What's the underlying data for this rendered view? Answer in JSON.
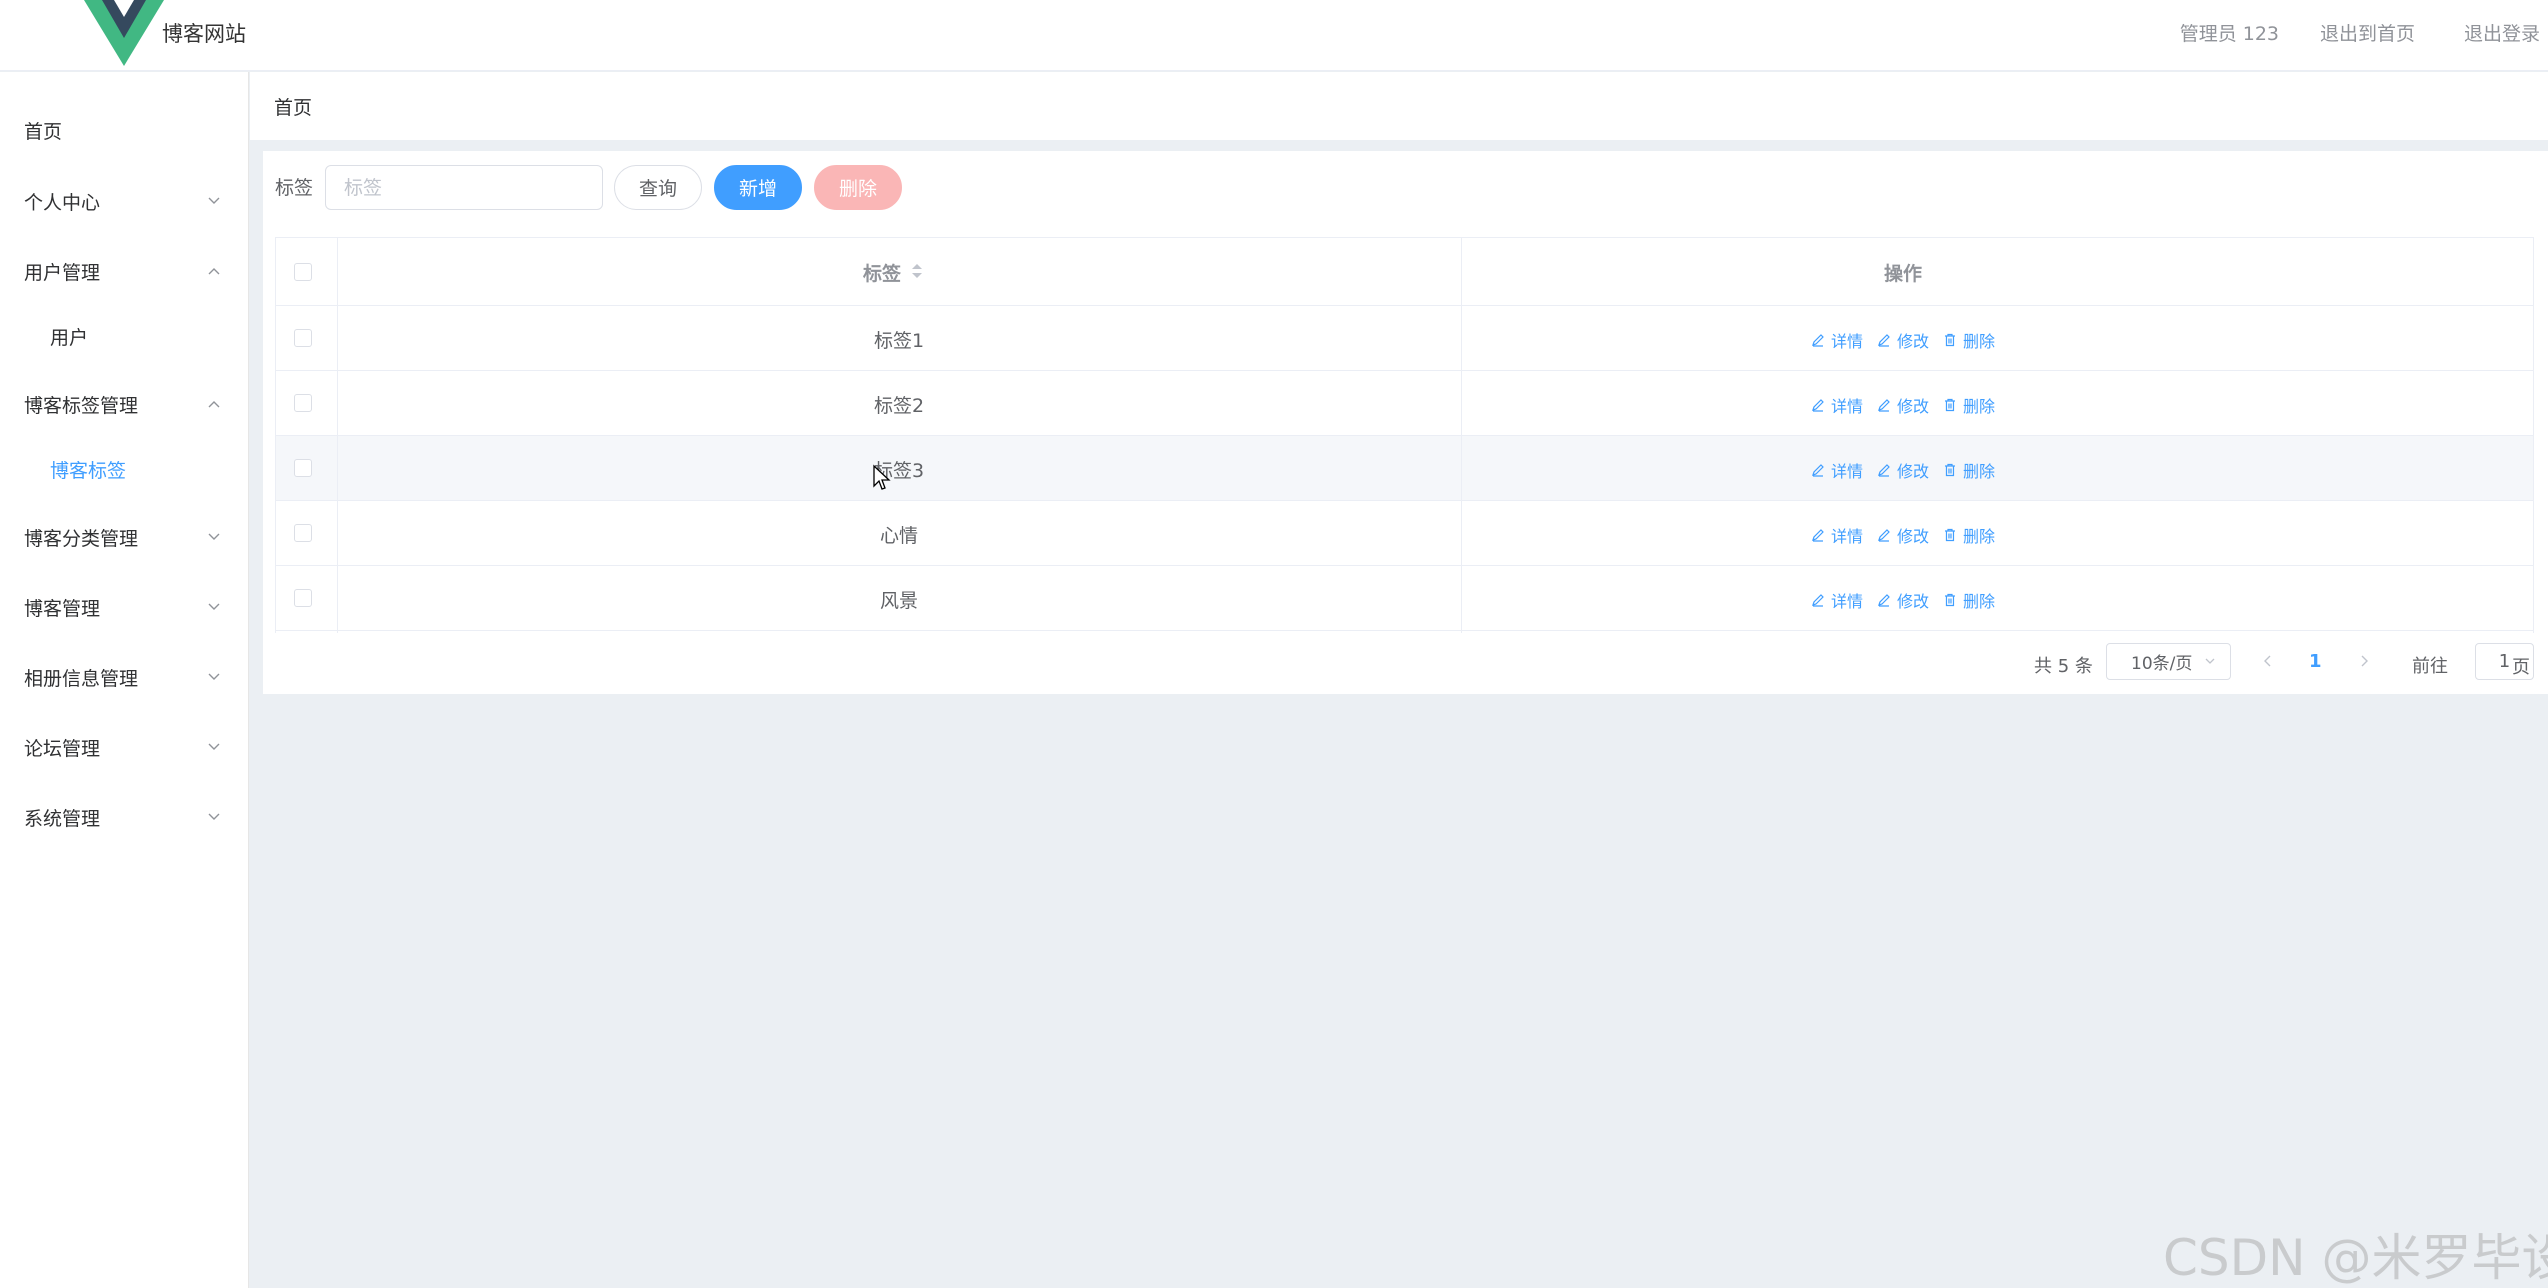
{
  "header": {
    "site_title": "博客网站",
    "user_label": "管理员 123",
    "back_home_label": "退出到首页",
    "logout_label": "退出登录",
    "logo_colors": {
      "outer": "#41b883",
      "inner": "#35495e"
    }
  },
  "sidebar": {
    "items": [
      {
        "label": "首页",
        "expandable": false,
        "expanded": false
      },
      {
        "label": "个人中心",
        "expandable": true,
        "expanded": false
      },
      {
        "label": "用户管理",
        "expandable": true,
        "expanded": true
      },
      {
        "label": "用户",
        "sub": true
      },
      {
        "label": "博客标签管理",
        "expandable": true,
        "expanded": true
      },
      {
        "label": "博客标签",
        "sub": true,
        "active": true
      },
      {
        "label": "博客分类管理",
        "expandable": true,
        "expanded": false
      },
      {
        "label": "博客管理",
        "expandable": true,
        "expanded": false
      },
      {
        "label": "相册信息管理",
        "expandable": true,
        "expanded": false
      },
      {
        "label": "论坛管理",
        "expandable": true,
        "expanded": false
      },
      {
        "label": "系统管理",
        "expandable": true,
        "expanded": false
      }
    ]
  },
  "breadcrumb": {
    "label": "首页"
  },
  "search": {
    "label": "标签",
    "placeholder": "标签",
    "value": "",
    "query_label": "查询",
    "add_label": "新增",
    "delete_label": "删除"
  },
  "table": {
    "columns": [
      "标签",
      "操作"
    ],
    "rows": [
      {
        "tag": "标签1"
      },
      {
        "tag": "标签2"
      },
      {
        "tag": "标签3"
      },
      {
        "tag": "心情"
      },
      {
        "tag": "风景"
      }
    ],
    "actions": {
      "detail": "详情",
      "edit": "修改",
      "delete": "删除"
    },
    "hovered_row_index": 2
  },
  "pagination": {
    "total_text": "共 5 条",
    "page_size_text": "10条/页",
    "current_page": "1",
    "goto_label": "前往",
    "goto_value": "1",
    "page_suffix": "页"
  },
  "watermark": "CSDN @米罗毕设",
  "colors": {
    "primary": "#409eff",
    "danger_light": "#fab6b6",
    "background": "#ebeff3"
  }
}
